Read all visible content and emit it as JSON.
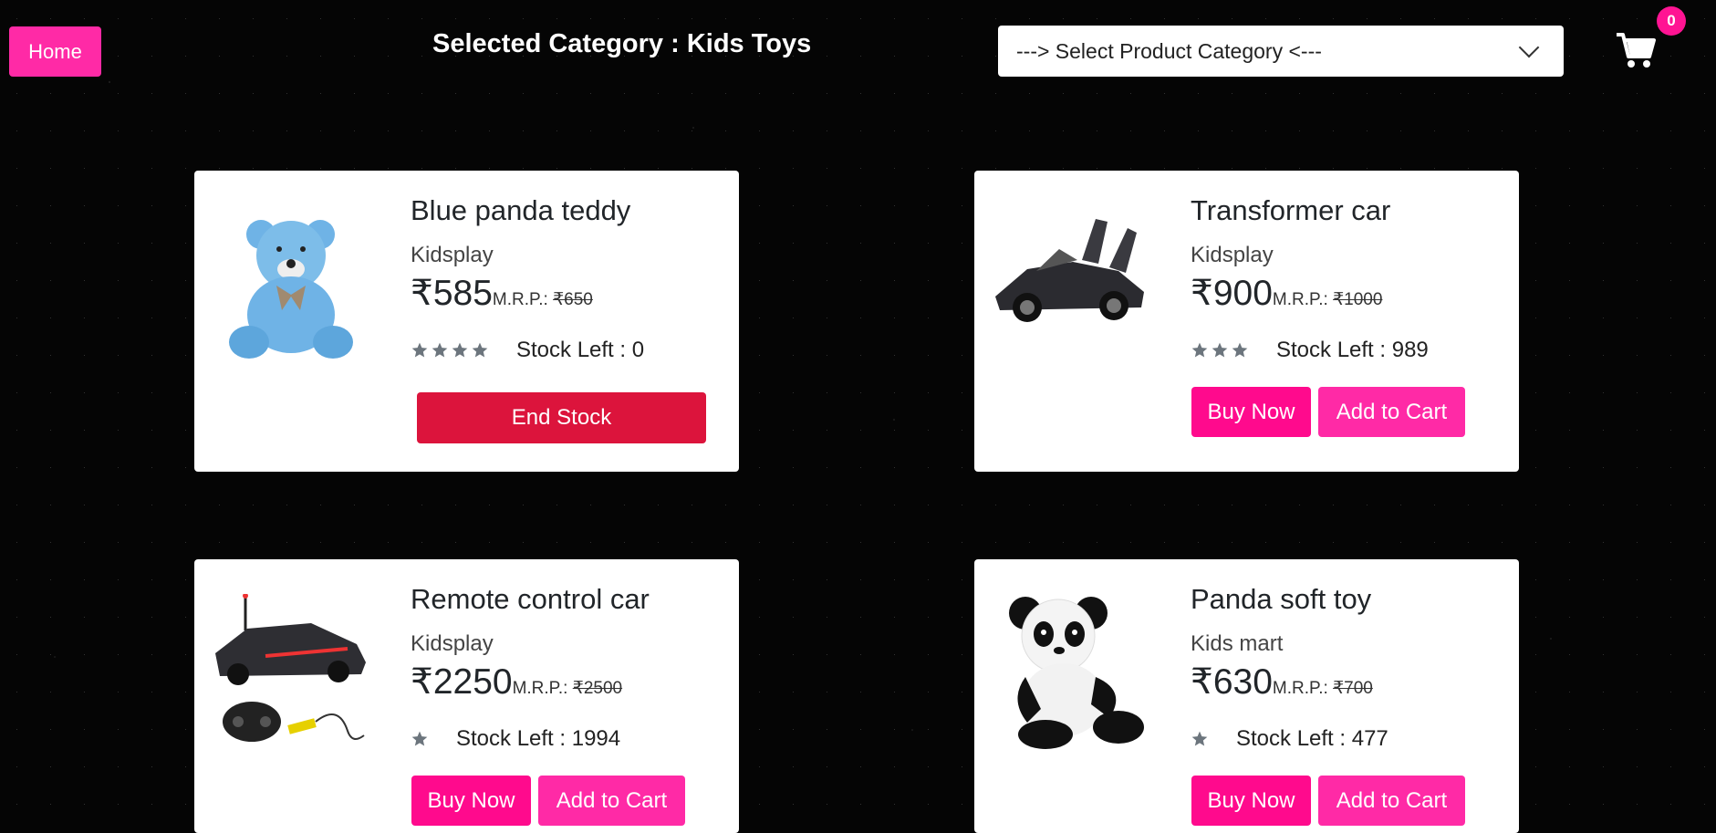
{
  "header": {
    "home_label": "Home",
    "title": "Selected Category : Kids Toys",
    "category_select_label": "---> Select Product Category <---",
    "cart_count": "0"
  },
  "colors": {
    "accent": "#ff2aa6",
    "buy": "#ff0a8d",
    "end_stock": "#dc143c",
    "star": "#6c757d"
  },
  "products": [
    {
      "name": "Blue panda teddy",
      "brand": "Kidsplay",
      "price": "₹585",
      "mrp_label": "M.R.P.: ",
      "mrp": "₹650",
      "stars": 4,
      "stock": "Stock Left : 0",
      "end_label": "End Stock",
      "icon": "teddy-bear-image"
    },
    {
      "name": "Transformer car",
      "brand": "Kidsplay",
      "price": "₹900",
      "mrp_label": "M.R.P.: ",
      "mrp": "₹1000",
      "stars": 3,
      "stock": "Stock Left : 989",
      "buy_label": "Buy Now",
      "cart_label": "Add to Cart",
      "icon": "sports-car-image"
    },
    {
      "name": "Remote control car",
      "brand": "Kidsplay",
      "price": "₹2250",
      "mrp_label": "M.R.P.: ",
      "mrp": "₹2500",
      "stars": 1,
      "stock": "Stock Left : 1994",
      "buy_label": "Buy Now",
      "cart_label": "Add to Cart",
      "icon": "rc-car-image"
    },
    {
      "name": "Panda soft toy",
      "brand": "Kids mart",
      "price": "₹630",
      "mrp_label": "M.R.P.: ",
      "mrp": "₹700",
      "stars": 1,
      "stock": "Stock Left : 477",
      "buy_label": "Buy Now",
      "cart_label": "Add to Cart",
      "icon": "panda-toy-image"
    }
  ]
}
